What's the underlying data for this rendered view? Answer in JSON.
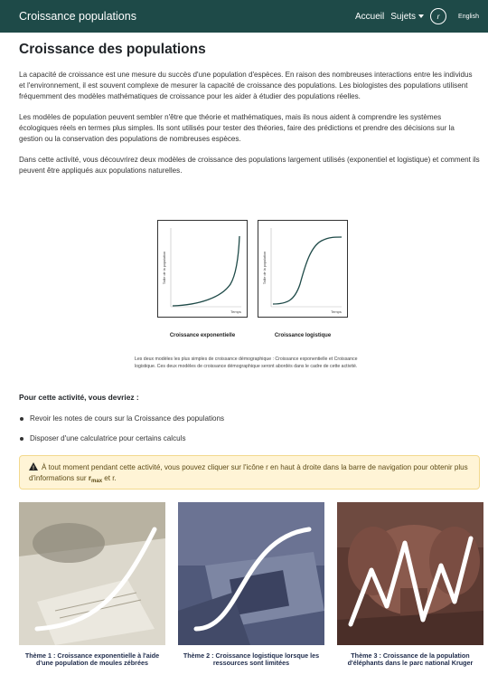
{
  "nav": {
    "brand": "Croissance populations",
    "home": "Accueil",
    "topics": "Sujets",
    "r_button": "r",
    "language": "English"
  },
  "page": {
    "title": "Croissance des populations",
    "paragraphs": [
      "La capacité de croissance est une mesure du succès d'une population d'espèces. En raison des nombreuses interactions entre les individus et l'environnement, il est souvent complexe de mesurer la capacité de croissance des populations. Les biologistes des populations utilisent fréquemment des modèles mathématiques de croissance pour les aider à étudier des populations réelles.",
      "Les modèles de population peuvent sembler n'être que théorie et mathématiques, mais ils nous aident à comprendre les systèmes écologiques réels en termes plus simples. Ils sont utilisés pour tester des théories, faire des prédictions et prendre des décisions sur la gestion ou la conservation des populations de nombreuses espèces.",
      "Dans cette activité, vous découvrirez deux modèles de croissance des populations largement utilisés (exponentiel et logistique) et comment ils peuvent être appliqués aux populations naturelles."
    ]
  },
  "figures": {
    "exp": {
      "ylabel": "Taille de la population",
      "xlabel": "Temps",
      "caption": "Croissance exponentielle"
    },
    "log": {
      "ylabel": "Taille de la population",
      "xlabel": "Temps",
      "caption": "Croissance logistique"
    },
    "caption": "Les deux modèles les plus simples de croissance démographique : Croissance exponentielle et Croissance logistique. Ces deux modèles de croissance démographique seront abordés dans le cadre de cette activité."
  },
  "tasks": {
    "heading": "Pour cette activité, vous devriez :",
    "items": [
      "Revoir les notes de cours sur la Croissance des populations",
      "Disposer d'une calculatrice pour certains calculs"
    ]
  },
  "alert": {
    "text_before": "À tout moment pendant cette activité, vous pouvez cliquer sur l'icône r en haut à droite dans la barre de navigation pour obtenir plus d'informations sur ",
    "r": "r",
    "max": "max",
    "text_after": " et r."
  },
  "cards": [
    {
      "title": "Thème 1 : Croissance exponentielle à l'aide d'une population de moules zébrées"
    },
    {
      "title": "Thème 2 : Croissance logistique lorsque les ressources sont limitées"
    },
    {
      "title": "Thème 3 : Croissance de la population d'éléphants dans le parc national Kruger"
    }
  ],
  "colors": {
    "navbar": "#1e4a48",
    "curve": "#1e4a48",
    "alert_bg": "#fff4d6"
  }
}
